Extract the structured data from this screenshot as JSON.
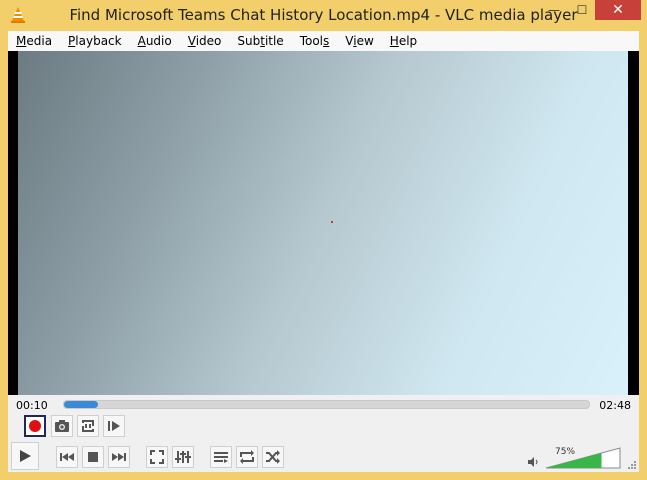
{
  "window": {
    "title": "Find Microsoft Teams Chat History Location.mp4 - VLC media player",
    "minimize_glyph": "—",
    "maximize_glyph": "☐",
    "close_glyph": "✕"
  },
  "menu": [
    {
      "label": "Media",
      "key": "M",
      "rest": "edia"
    },
    {
      "label": "Playback",
      "key": "P",
      "rest": "layback"
    },
    {
      "label": "Audio",
      "key": "A",
      "rest": "udio"
    },
    {
      "label": "Video",
      "key": "V",
      "rest": "ideo"
    },
    {
      "label": "Subtitle",
      "key": "t",
      "pre": "Sub",
      "rest": "itle"
    },
    {
      "label": "Tools",
      "key": "s",
      "pre": "Tool",
      "rest": ""
    },
    {
      "label": "View",
      "key": "i",
      "pre": "V",
      "rest": "ew"
    },
    {
      "label": "Help",
      "key": "H",
      "rest": "elp"
    }
  ],
  "player": {
    "elapsed": "00:10",
    "total": "02:48",
    "progress": 0.065,
    "volume_label": "75%",
    "volume": 0.75
  },
  "colors": {
    "accent": "#3b8ad6",
    "volume_fill": "#39b54a",
    "record": "#e01010",
    "frame": "#f2cf6a"
  },
  "icons": {
    "record": "record-icon",
    "snapshot": "camera-icon",
    "loop_ab": "loop-ab-icon",
    "frame_step": "frame-step-icon",
    "play": "play-icon",
    "previous": "previous-icon",
    "stop": "stop-icon",
    "next": "next-icon",
    "fullscreen": "fullscreen-icon",
    "extended": "equalizer-icon",
    "playlist": "playlist-icon",
    "loop": "loop-icon",
    "shuffle": "shuffle-icon",
    "volume": "speaker-icon"
  }
}
